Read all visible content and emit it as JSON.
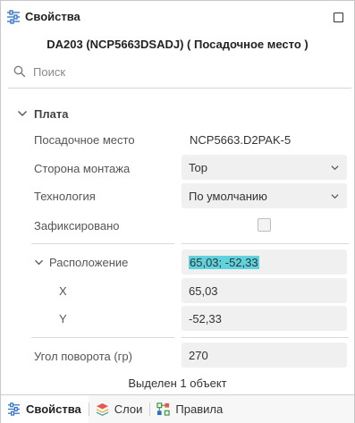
{
  "panel": {
    "title": "Свойства"
  },
  "component": {
    "title": "DA203 (NCP5663DSADJ) ( Посадочное место )"
  },
  "search": {
    "placeholder": "Поиск",
    "value": ""
  },
  "group": {
    "label": "Плата",
    "rows": {
      "footprint": {
        "label": "Посадочное место",
        "value": "NCP5663.D2PAK-5"
      },
      "side": {
        "label": "Сторона монтажа",
        "value": "Top"
      },
      "technology": {
        "label": "Технология",
        "value": "По умолчанию"
      },
      "locked": {
        "label": "Зафиксировано",
        "checked": false
      },
      "location": {
        "label": "Расположение",
        "value": "65,03; -52,33"
      },
      "x": {
        "label": "X",
        "value": "65,03"
      },
      "y": {
        "label": "Y",
        "value": "-52,33"
      },
      "rotation": {
        "label": "Угол поворота (гр)",
        "value": "270"
      }
    }
  },
  "status": "Выделен 1 объект",
  "tabs": [
    {
      "label": "Свойства",
      "icon": "properties-icon",
      "active": true
    },
    {
      "label": "Слои",
      "icon": "layers-icon",
      "active": false
    },
    {
      "label": "Правила",
      "icon": "rules-icon",
      "active": false
    }
  ],
  "colors": {
    "highlight": "#5ed3dd",
    "field_bg": "#f0f0f0",
    "accent_blue": "#2b6fc9"
  }
}
